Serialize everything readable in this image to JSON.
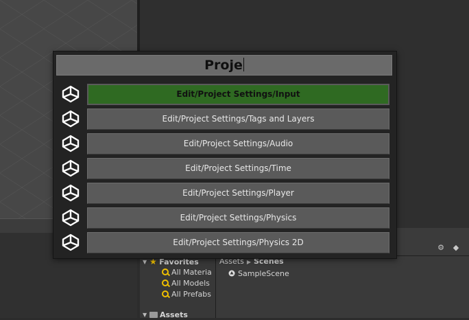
{
  "search": {
    "query": "Proje"
  },
  "results": [
    {
      "label": "Edit/Project Settings/Input",
      "selected": true,
      "icon": "unity-logo-icon"
    },
    {
      "label": "Edit/Project Settings/Tags and Layers",
      "selected": false,
      "icon": "unity-logo-icon"
    },
    {
      "label": "Edit/Project Settings/Audio",
      "selected": false,
      "icon": "unity-logo-icon"
    },
    {
      "label": "Edit/Project Settings/Time",
      "selected": false,
      "icon": "unity-logo-icon"
    },
    {
      "label": "Edit/Project Settings/Player",
      "selected": false,
      "icon": "unity-logo-icon"
    },
    {
      "label": "Edit/Project Settings/Physics",
      "selected": false,
      "icon": "unity-logo-icon"
    },
    {
      "label": "Edit/Project Settings/Physics 2D",
      "selected": false,
      "icon": "unity-logo-icon"
    }
  ],
  "project": {
    "favorites": {
      "label": "Favorites",
      "items": [
        "All Materia",
        "All Models",
        "All Prefabs"
      ]
    },
    "assets_label": "Assets",
    "breadcrumb": [
      "Assets",
      "Scenes"
    ],
    "files": [
      "SampleScene"
    ]
  },
  "colors": {
    "selected_row": "#2f6a22",
    "button": "#5a5a5a",
    "popup_bg": "#232323",
    "search_bg": "#6a6a6a",
    "favorites_star": "#f2c200"
  }
}
